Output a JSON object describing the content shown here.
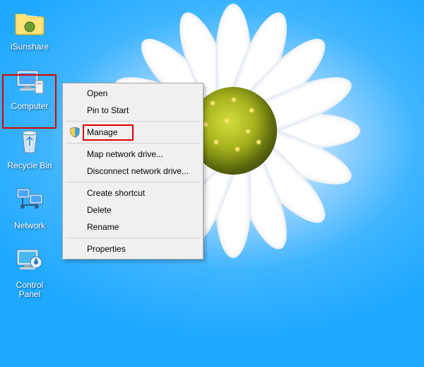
{
  "desktop_icons": {
    "isunshare": {
      "label": "iSunshare"
    },
    "computer": {
      "label": "Computer"
    },
    "recyclebin": {
      "label": "Recycle Bin"
    },
    "network": {
      "label": "Network"
    },
    "controlpanel": {
      "label": "Control Panel"
    }
  },
  "context_menu": {
    "open": "Open",
    "pin": "Pin to Start",
    "manage": "Manage",
    "mapnet": "Map network drive...",
    "discnet": "Disconnect network drive...",
    "shortcut": "Create shortcut",
    "delete": "Delete",
    "rename": "Rename",
    "props": "Properties"
  },
  "highlights": {
    "selected_icon": "computer",
    "highlighted_menu_item": "manage"
  }
}
